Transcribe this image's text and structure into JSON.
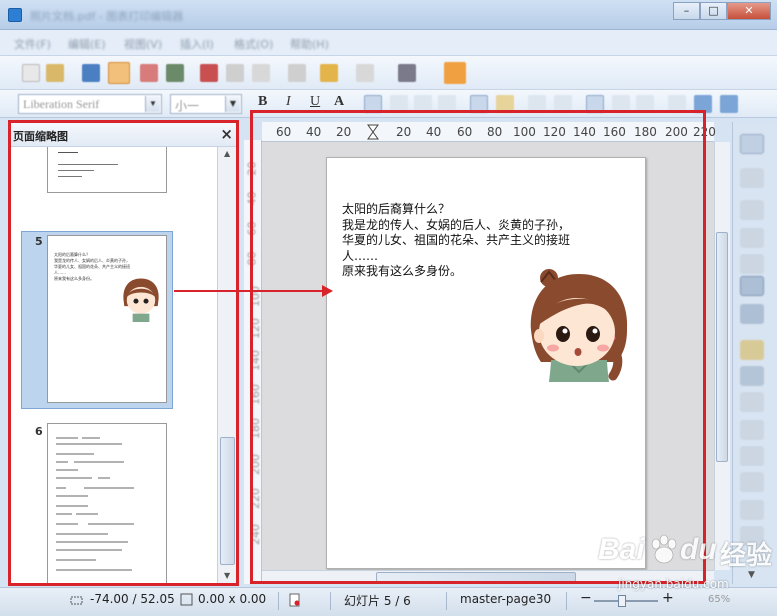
{
  "window": {
    "title": "照片文档.pdf - 图表打印编辑器",
    "buttons": [
      "–",
      "□",
      "✕"
    ]
  },
  "menu": {
    "items": [
      "文件(F)",
      "编辑(E)",
      "视图(V)",
      "插入(I)",
      "格式(O)",
      "帮助(H)"
    ]
  },
  "toolbar": {
    "font_name": "Liberation Serif",
    "font_size": "小一",
    "bold": "B",
    "italic": "I",
    "underline": "U",
    "shadow": "A"
  },
  "thumbnail_panel": {
    "title": "页面缩略图",
    "close": "×",
    "pages": [
      {
        "number": "5",
        "lines": [
          "太阳的后裔算什么？",
          "我是龙的传人、女娲的后人、炎黄的子孙，",
          "华夏的儿女、祖国的花朵、共产主义的接班",
          "人……",
          "原来我有这么多身份。"
        ]
      },
      {
        "number": "6"
      }
    ]
  },
  "rulers": {
    "horizontal": [
      "60",
      "40",
      "20",
      "20",
      "40",
      "60",
      "80",
      "100",
      "120",
      "140",
      "160",
      "180",
      "200",
      "220"
    ],
    "vertical": [
      "20",
      "40",
      "60",
      "80",
      "100",
      "120",
      "140",
      "160",
      "180",
      "200",
      "220",
      "240"
    ]
  },
  "page": {
    "lines": [
      "太阳的后裔算什么？",
      "我是龙的传人、女娲的后人、炎黄的子孙，",
      "华夏的儿女、祖国的花朵、共产主义的接班",
      "人……",
      "原来我有这么多身份。"
    ]
  },
  "statusbar": {
    "position": "-74.00 / 52.05",
    "size": "0.00 x 0.00",
    "slide": "幻灯片 5 / 6",
    "master": "master-page30",
    "zoom": "65%"
  },
  "watermark": {
    "brand": "Bai",
    "brand2": "du",
    "jingyan": "经验",
    "url": "jingyan.baidu.com"
  },
  "colors": {
    "highlight": "#d9232a",
    "selection": "#bdd4ee"
  }
}
